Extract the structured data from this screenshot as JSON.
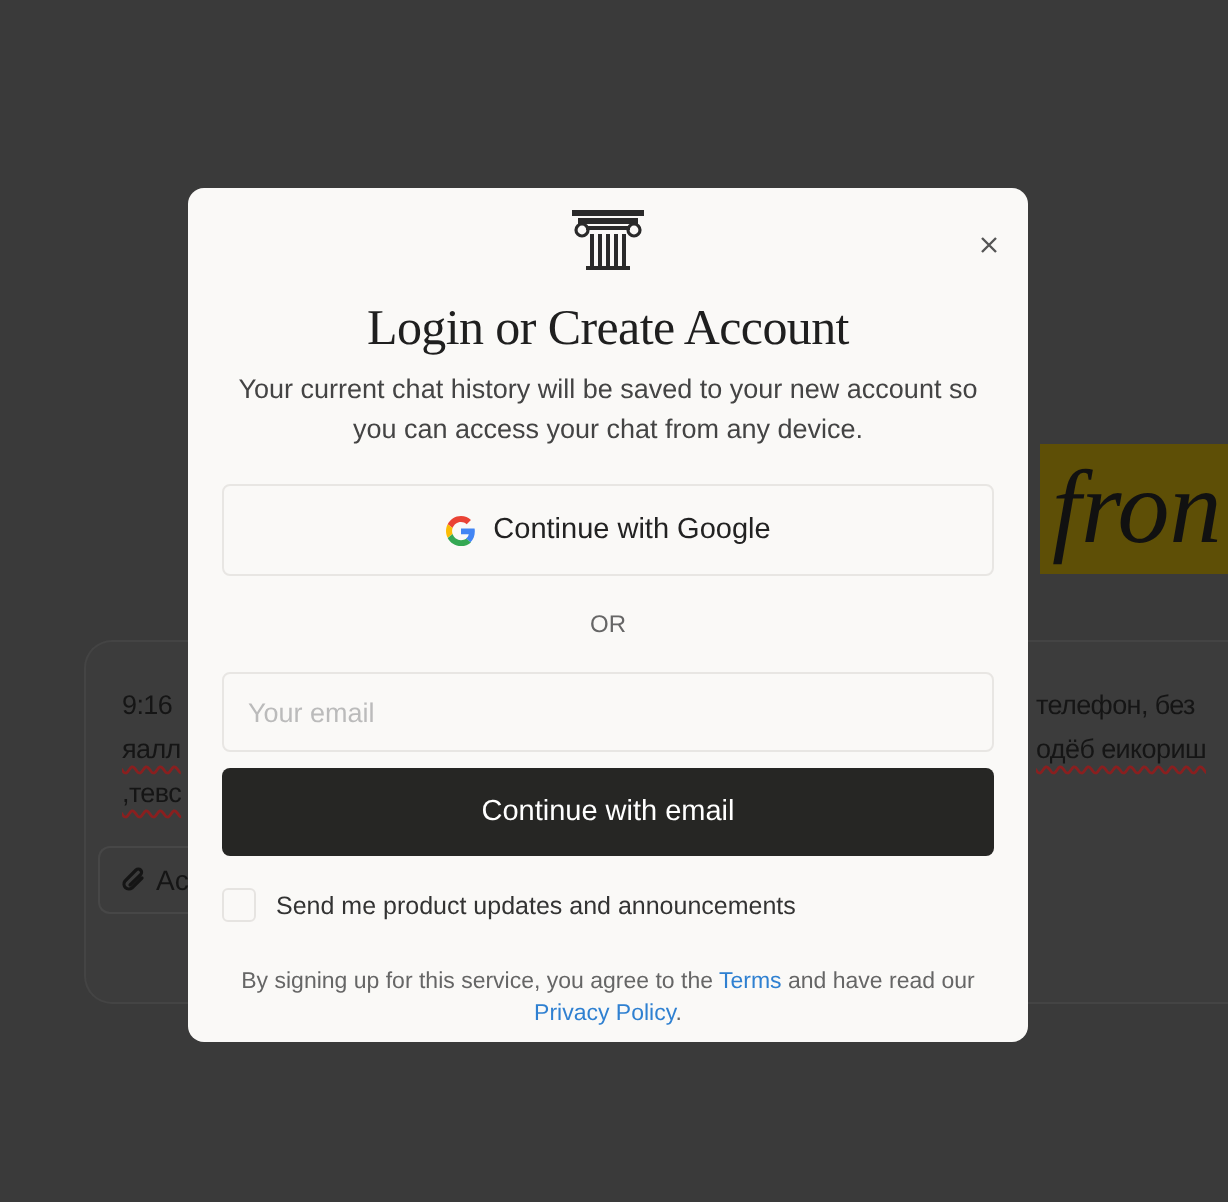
{
  "background": {
    "heading_fragment": "fron",
    "card": {
      "left_lines": [
        {
          "text": "9:16",
          "misspelled": false
        },
        {
          "text": "яалл",
          "misspelled": true
        },
        {
          "text": ",тевс",
          "misspelled": true
        }
      ],
      "right_lines": [
        {
          "text": "телефон, без",
          "misspelled": false
        },
        {
          "text": "одёб еикориш",
          "misspelled": true
        }
      ],
      "attach_button": "Ac"
    }
  },
  "dialog": {
    "title": "Login or Create Account",
    "subtitle": "Your current chat history will be saved to your new account so you can access your chat from any device.",
    "google_button": "Continue with Google",
    "divider": "OR",
    "email_field": {
      "placeholder": "Your email"
    },
    "email_button": "Continue with email",
    "updates_checkbox": {
      "label": "Send me product updates and announcements",
      "checked": false
    },
    "legal": {
      "before": "By signing up for this service, you agree to the ",
      "terms_link": "Terms",
      "middle": " and have read our ",
      "privacy_link": "Privacy Policy",
      "after": "."
    }
  }
}
